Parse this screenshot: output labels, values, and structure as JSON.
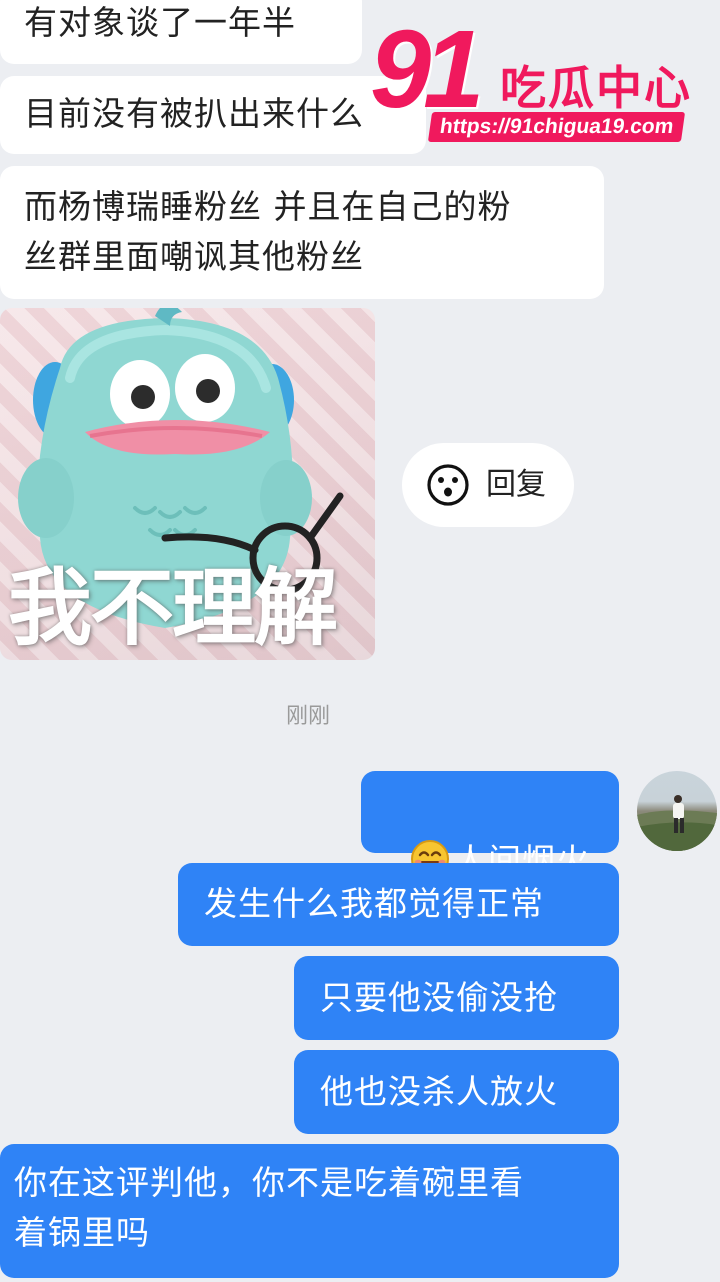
{
  "messages_in": [
    {
      "text": "有对象谈了一年半"
    },
    {
      "text": "目前没有被扒出来什么"
    },
    {
      "text": "而杨博瑞睡粉丝 并且在自己的粉\n丝群里面嘲讽其他粉丝"
    }
  ],
  "sticker": {
    "caption": "我不理解"
  },
  "reply_button": {
    "label": "回复",
    "icon": "smiley-face-icon"
  },
  "timestamp": "刚刚",
  "messages_out": [
    {
      "emoji": "smiling-face-emoji",
      "text": "人间烟火"
    },
    {
      "text": "发生什么我都觉得正常"
    },
    {
      "text": "只要他没偷没抢"
    },
    {
      "text": "他也没杀人放火"
    },
    {
      "text": "你在这评判他，你不是吃着碗里看\n着锅里吗"
    }
  ],
  "watermark": {
    "brand_number": "91",
    "brand_name": "吃瓜中心",
    "url": "https://91chigua19.com"
  },
  "colors": {
    "background": "#eceef2",
    "incoming_bubble": "#ffffff",
    "outgoing_bubble": "#2f83f6",
    "watermark": "#f0195d"
  }
}
